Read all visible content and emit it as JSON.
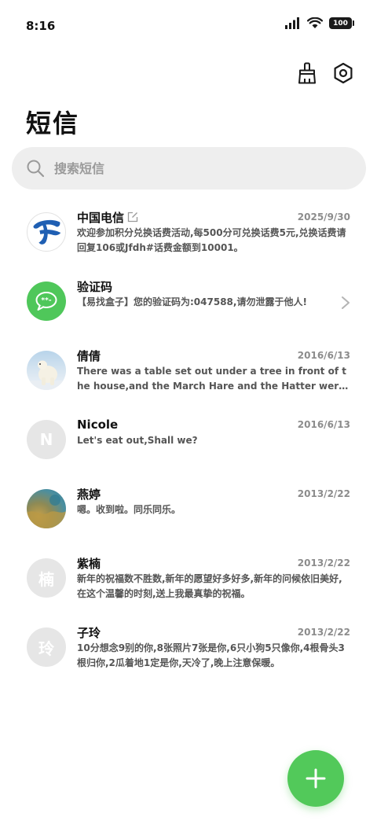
{
  "status_bar": {
    "time": "8:16",
    "battery": "100"
  },
  "header": {
    "title": "短信"
  },
  "search": {
    "placeholder": "搜索短信"
  },
  "conversations": [
    {
      "name": "中国电信",
      "date": "2025/9/30",
      "preview": "欢迎参加积分兑换话费活动,每500分可兑换话费5元,兑换话费请回复106或Jfdh#话费金额到10001。",
      "avatar": "telecom-logo",
      "avatar_text": ""
    },
    {
      "name": "验证码",
      "date": "",
      "preview": "【易找盒子】您的验证码为:047588,请勿泄露于他人!",
      "avatar": "message-bubble",
      "avatar_text": ""
    },
    {
      "name": "倩倩",
      "date": "2016/6/13",
      "preview": "There was a table set out under a tree in front of the house,and the March Hare and the Hatter were having tea at it.",
      "avatar": "polar-bear-photo",
      "avatar_text": ""
    },
    {
      "name": "Nicole",
      "date": "2016/6/13",
      "preview": "Let's eat out,Shall we?",
      "avatar": "letter",
      "avatar_text": "N"
    },
    {
      "name": "燕婷",
      "date": "2013/2/22",
      "preview": "嗯。收到啦。同乐同乐。",
      "avatar": "landscape-photo",
      "avatar_text": ""
    },
    {
      "name": "紫楠",
      "date": "2013/2/22",
      "preview": "新年的祝福数不胜数,新年的愿望好多好多,新年的问候依旧美好,在这个温馨的时刻,送上我最真挚的祝福。",
      "avatar": "letter",
      "avatar_text": "楠"
    },
    {
      "name": "子玲",
      "date": "2013/2/22",
      "preview": "10分想念9别的你,8张照片7张是你,6只小狗5只像你,4根骨头3根归你,2瓜着地1定是你,天冷了,晚上注意保暖。",
      "avatar": "letter",
      "avatar_text": "玲"
    }
  ],
  "colors": {
    "accent": "#52c95a",
    "telecom_blue": "#1f5fb3",
    "search_bg": "#eeeeee",
    "avatar_gray": "#e6e6e6"
  },
  "icons": {
    "clean": "broom-icon",
    "settings": "settings-hex-icon",
    "search": "search-icon",
    "compose": "plus-icon",
    "edit": "edit-icon",
    "chevron": "chevron-right-icon"
  }
}
